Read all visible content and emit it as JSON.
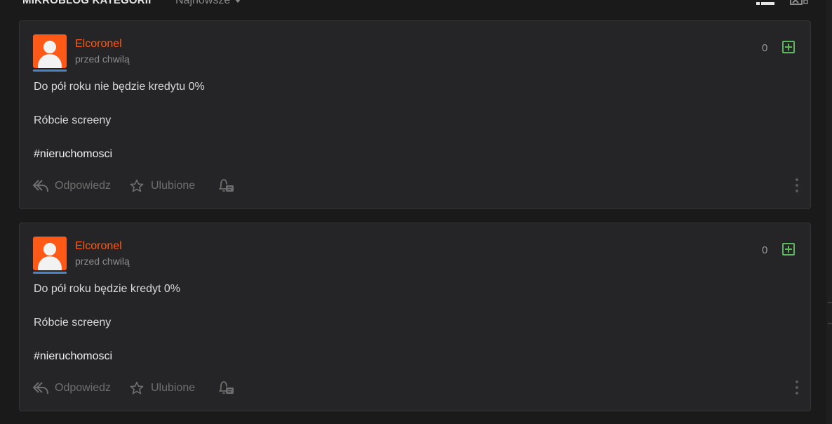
{
  "header": {
    "title": "MIKROBLOG KATEGORII",
    "sort_label": "Najnowsze"
  },
  "posts": [
    {
      "author": "Elcoronel",
      "time": "przed chwilą",
      "votes": "0",
      "lines": [
        "Do pół roku nie będzie kredytu 0%",
        "Róbcie screeny",
        "#nieruchomosci"
      ],
      "reply_label": "Odpowiedz",
      "favorite_label": "Ulubione"
    },
    {
      "author": "Elcoronel",
      "time": "przed chwilą",
      "votes": "0",
      "lines": [
        "Do pół roku będzie kredyt 0%",
        "Róbcie screeny",
        "#nieruchomosci"
      ],
      "reply_label": "Odpowiedz",
      "favorite_label": "Ulubione"
    }
  ],
  "colors": {
    "accent": "#ff5917",
    "upvote": "#5cb85c",
    "avatar_underline": "#4a86c5",
    "background": "#1a1a1b",
    "card": "#252527"
  },
  "icons": [
    "list-view-icon",
    "image-view-icon",
    "reply-icon",
    "star-icon",
    "bell-icon",
    "plus-icon",
    "more-icon"
  ]
}
